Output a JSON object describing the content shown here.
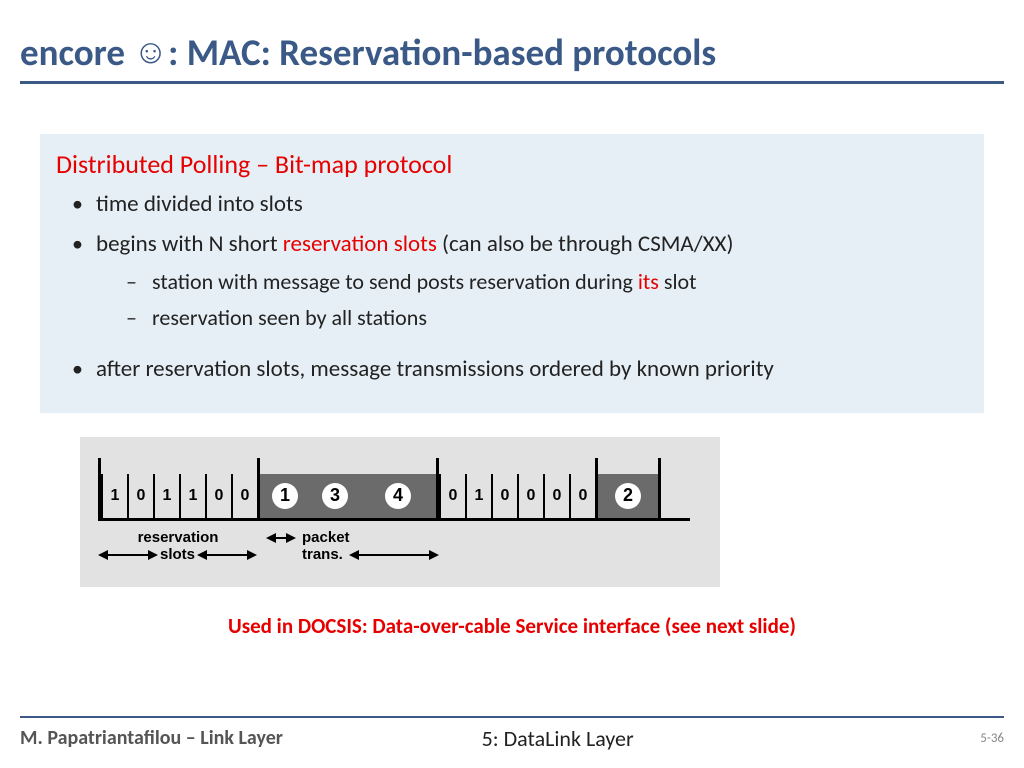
{
  "title": {
    "part1": "encore ",
    "smiley": "☺",
    "part2": ": MAC: Reservation-based protocols"
  },
  "box": {
    "heading": "Distributed Polling – Bit-map protocol",
    "b1": "time divided into slots",
    "b2a": "begins with N short ",
    "b2b_red": "reservation slots",
    "b2c": " (can also be through CSMA/XX)",
    "b2_1a": "station with message to send posts reservation during ",
    "b2_1b_red": "its",
    "b2_1c": " slot",
    "b2_2": "reservation seen by all stations",
    "b3": "after reservation slots, message transmissions ordered by known priority"
  },
  "diagram": {
    "slots1": [
      "1",
      "0",
      "1",
      "1",
      "0",
      "0"
    ],
    "packets1": [
      "1",
      "3",
      "4"
    ],
    "slots2": [
      "0",
      "1",
      "0",
      "0",
      "0",
      "0"
    ],
    "packets2": [
      "2"
    ],
    "label1a": "reservation",
    "label1b": "slots",
    "label2a": "packet",
    "label2b": "trans."
  },
  "docsis": "Used in DOCSIS: Data-over-cable Service interface (see next slide)",
  "footer": {
    "left": "M. Papatriantafilou –  Link Layer",
    "center": "5: DataLink Layer",
    "right": "5-36"
  }
}
